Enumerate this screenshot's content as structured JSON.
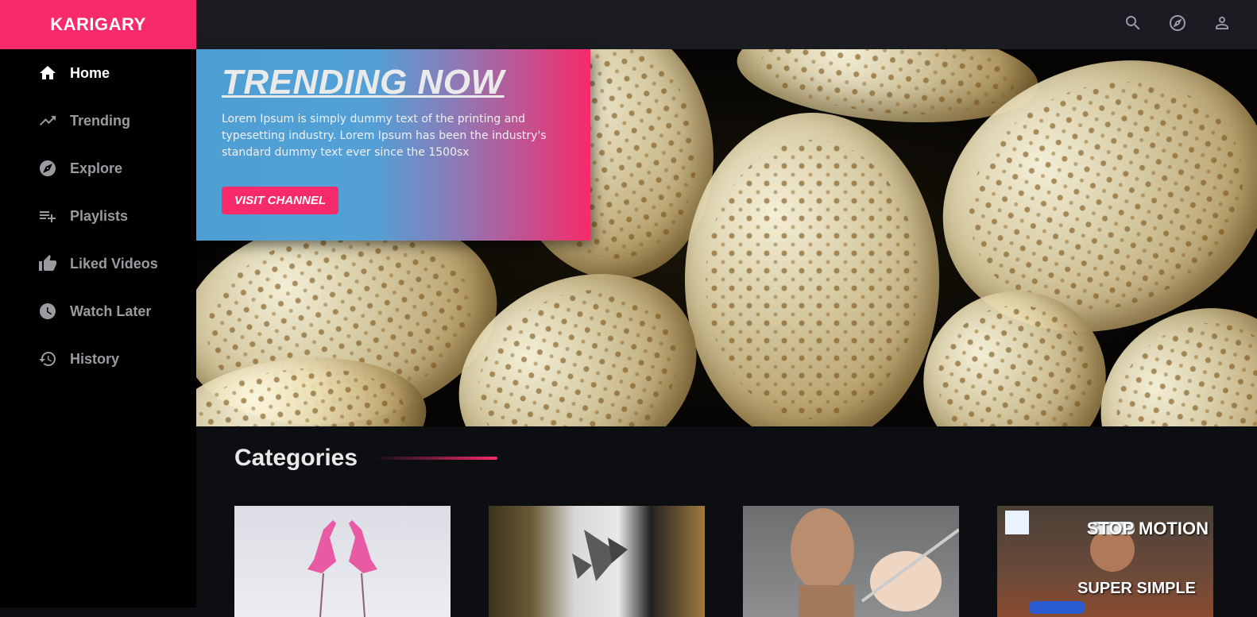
{
  "brand": {
    "name": "KARIGARY",
    "accent": "#f72a6b"
  },
  "sidebar": {
    "items": [
      {
        "label": "Home",
        "icon": "home-icon",
        "active": true
      },
      {
        "label": "Trending",
        "icon": "trending-up-icon",
        "active": false
      },
      {
        "label": "Explore",
        "icon": "compass-icon",
        "active": false
      },
      {
        "label": "Playlists",
        "icon": "playlist-add-icon",
        "active": false
      },
      {
        "label": "Liked Videos",
        "icon": "thumb-up-icon",
        "active": false
      },
      {
        "label": "Watch Later",
        "icon": "clock-icon",
        "active": false
      },
      {
        "label": "History",
        "icon": "history-icon",
        "active": false
      }
    ]
  },
  "topbar": {
    "icons": [
      "search-icon",
      "compass-icon",
      "user-icon"
    ]
  },
  "hero": {
    "title": "TRENDING NOW",
    "description": "Lorem Ipsum is simply dummy text of the printing and typesetting industry. Lorem Ipsum has been the industry's standard dummy text ever since the 1500sx",
    "button_label": "VISIT CHANNEL"
  },
  "categories": {
    "heading": "Categories",
    "thumbnails": [
      {
        "subject": "origami flamingos"
      },
      {
        "subject": "geometric paper sculpture"
      },
      {
        "subject": "clay bust sculpting"
      },
      {
        "subject": "stop motion",
        "text_top": "STOP MOTION",
        "text_bottom": "SUPER SIMPLE"
      }
    ]
  }
}
